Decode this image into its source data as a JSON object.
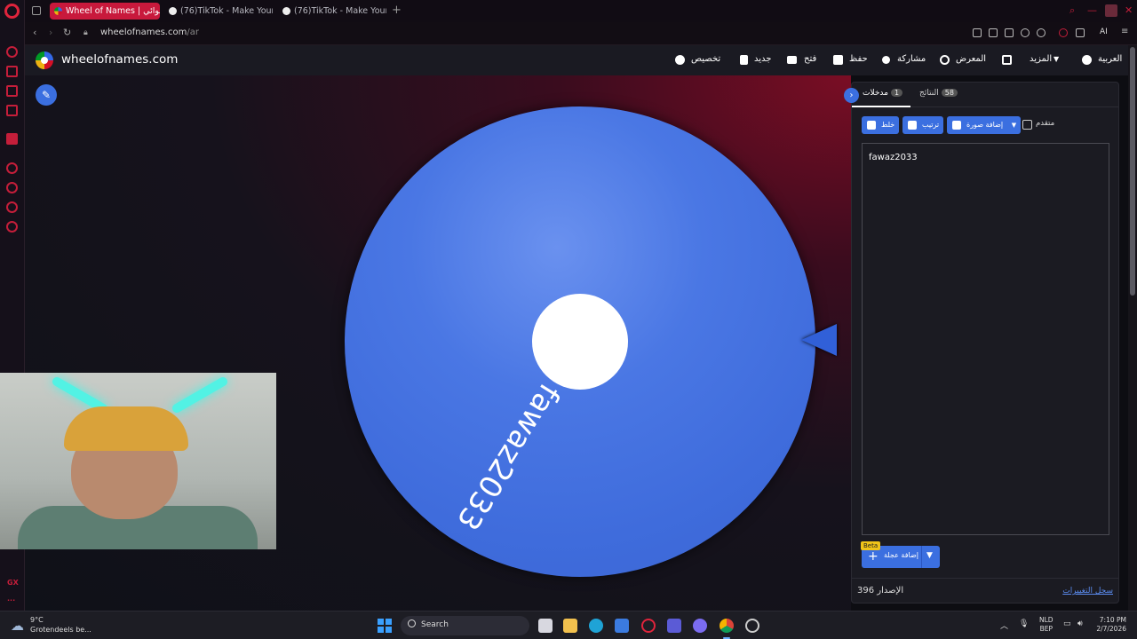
{
  "browser": {
    "tabs": [
      {
        "label": "Wheel of Names | العشوائي",
        "active": true
      },
      {
        "label": "(76)TikTok - Make Your Da",
        "active": false
      },
      {
        "label": "(76)TikTok - Make Your Da",
        "active": false
      }
    ],
    "url_host": "wheelofnames.com",
    "url_path": "/ar",
    "ai_label": "AI",
    "sidebar_label": "GX"
  },
  "site": {
    "title": "wheelofnames.com",
    "menu": {
      "customize": "تخصيص",
      "new": "جديد",
      "open": "فتح",
      "save": "حفظ",
      "share": "مشاركة",
      "gallery": "المعرض",
      "more": "المزيد",
      "language": "العربية"
    }
  },
  "wheel": {
    "entries": [
      "fawaz2033"
    ],
    "colors": {
      "segment": "#4a77e4",
      "pointer": "#3160d8"
    }
  },
  "panel": {
    "tabs": {
      "entries_label": "مدخلات",
      "entries_count": "1",
      "results_label": "النتائج",
      "results_count": "58"
    },
    "tools": {
      "shuffle": "خلط",
      "sort": "ترتيب",
      "add_image": "إضافة صورة",
      "advanced": "متقدم"
    },
    "entries_text": "fawaz2033",
    "add_wheel": "إضافة عجلة",
    "beta": "Beta",
    "version_label": "الإصدار",
    "version_number": "396",
    "changelog": "سجل التغييرات"
  },
  "taskbar": {
    "weather_temp": "9°C",
    "weather_desc": "Grotendeels be...",
    "search_placeholder": "Search",
    "lang_top": "NLD",
    "lang_bottom": "BEP",
    "time": "7:10 PM",
    "date": "2/7/2026"
  }
}
